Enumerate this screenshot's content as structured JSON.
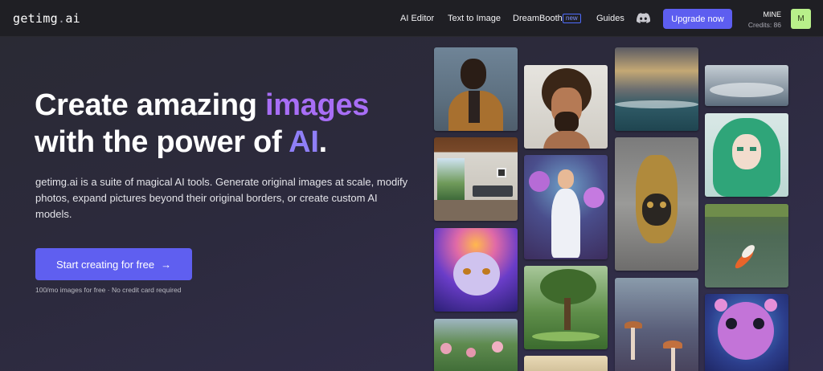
{
  "header": {
    "logo_main": "getimg",
    "logo_dot": ".",
    "logo_suffix": "ai",
    "nav": {
      "ai_editor": "AI Editor",
      "text_to_image": "Text to Image",
      "dreambooth": "DreamBooth",
      "dreambooth_badge": "new",
      "guides": "Guides"
    },
    "discord_icon": "discord-icon",
    "upgrade_label": "Upgrade now",
    "account_name": "MINE",
    "credits": "Credits: 86",
    "avatar_letter": "M",
    "avatar_color": "#b8f08a"
  },
  "hero": {
    "title_part1": "Create amazing ",
    "title_highlight1": "images",
    "title_part2": "with the power of ",
    "title_highlight2": "AI",
    "title_end": ".",
    "description": "getimg.ai is a suite of magical AI tools. Generate original images at scale, modify photos, expand pictures beyond their original borders, or create custom AI models.",
    "cta_label": "Start creating for free",
    "cta_icon": "arrow-right-icon",
    "note": "100/mo images for free · No credit card required"
  },
  "colors": {
    "accent": "#5f5ff0",
    "highlight_purple": "#a86ef6",
    "highlight_blue": "#8f7ff7"
  }
}
